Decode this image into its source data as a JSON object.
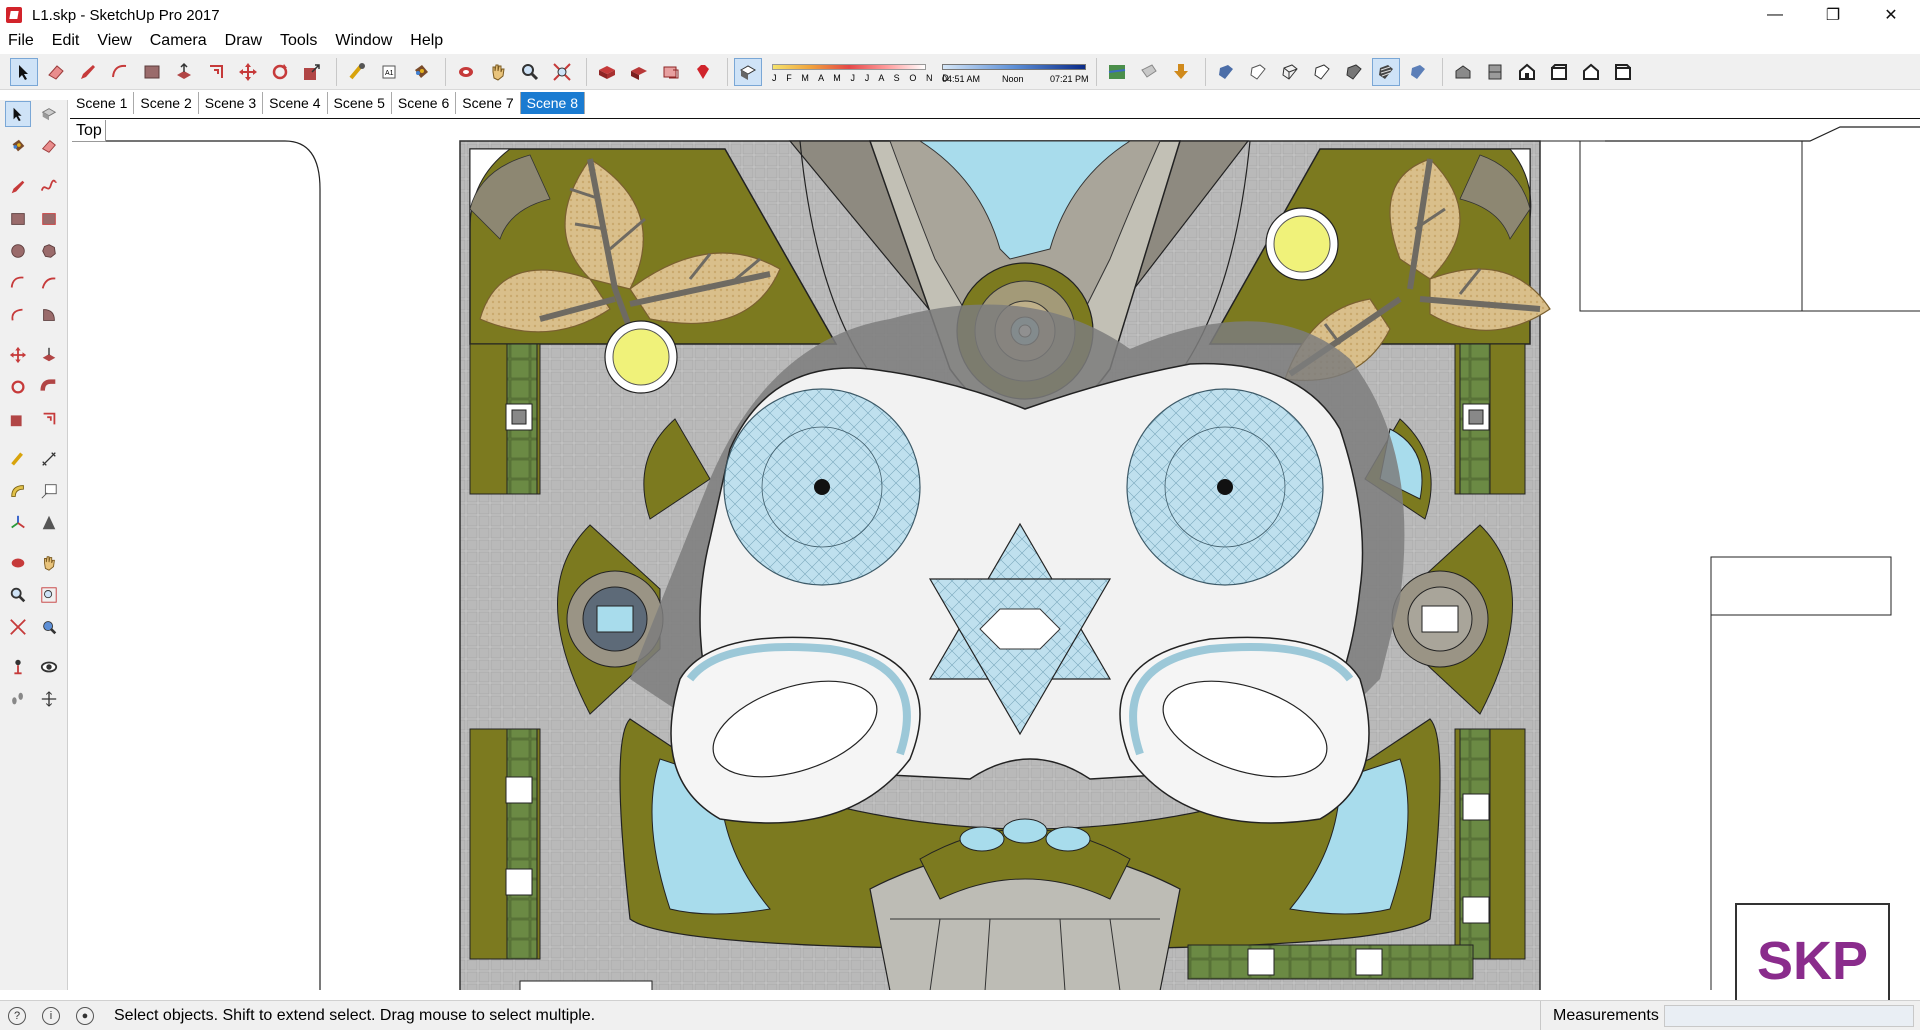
{
  "window": {
    "title": "L1.skp - SketchUp Pro 2017",
    "controls": {
      "minimize": "—",
      "restore": "❐",
      "close": "✕"
    }
  },
  "menu": [
    "File",
    "Edit",
    "View",
    "Camera",
    "Draw",
    "Tools",
    "Window",
    "Help"
  ],
  "toolbar": {
    "shadow_months": "J F M A M J J A S O N D",
    "shadow_time_start": "04:51 AM",
    "shadow_time_mid": "Noon",
    "shadow_time_end": "07:21 PM"
  },
  "scenes": [
    {
      "label": "Scene 1",
      "active": false
    },
    {
      "label": "Scene 2",
      "active": false
    },
    {
      "label": "Scene 3",
      "active": false
    },
    {
      "label": "Scene 4",
      "active": false
    },
    {
      "label": "Scene 5",
      "active": false
    },
    {
      "label": "Scene 6",
      "active": false
    },
    {
      "label": "Scene 7",
      "active": false
    },
    {
      "label": "Scene 8",
      "active": true
    }
  ],
  "viewport": {
    "view_name": "Top",
    "watermark": "SKP"
  },
  "status": {
    "hint": "Select objects. Shift to extend select. Drag mouse to select multiple.",
    "measurements_label": "Measurements",
    "measurements_value": ""
  },
  "colors": {
    "accent": "#1a7bd1",
    "olive": "#7c7a1f",
    "water": "#a8dcec",
    "paving": "#bdbdbd",
    "leaf": "#cfb07a",
    "skp": "#8a2c8c"
  }
}
